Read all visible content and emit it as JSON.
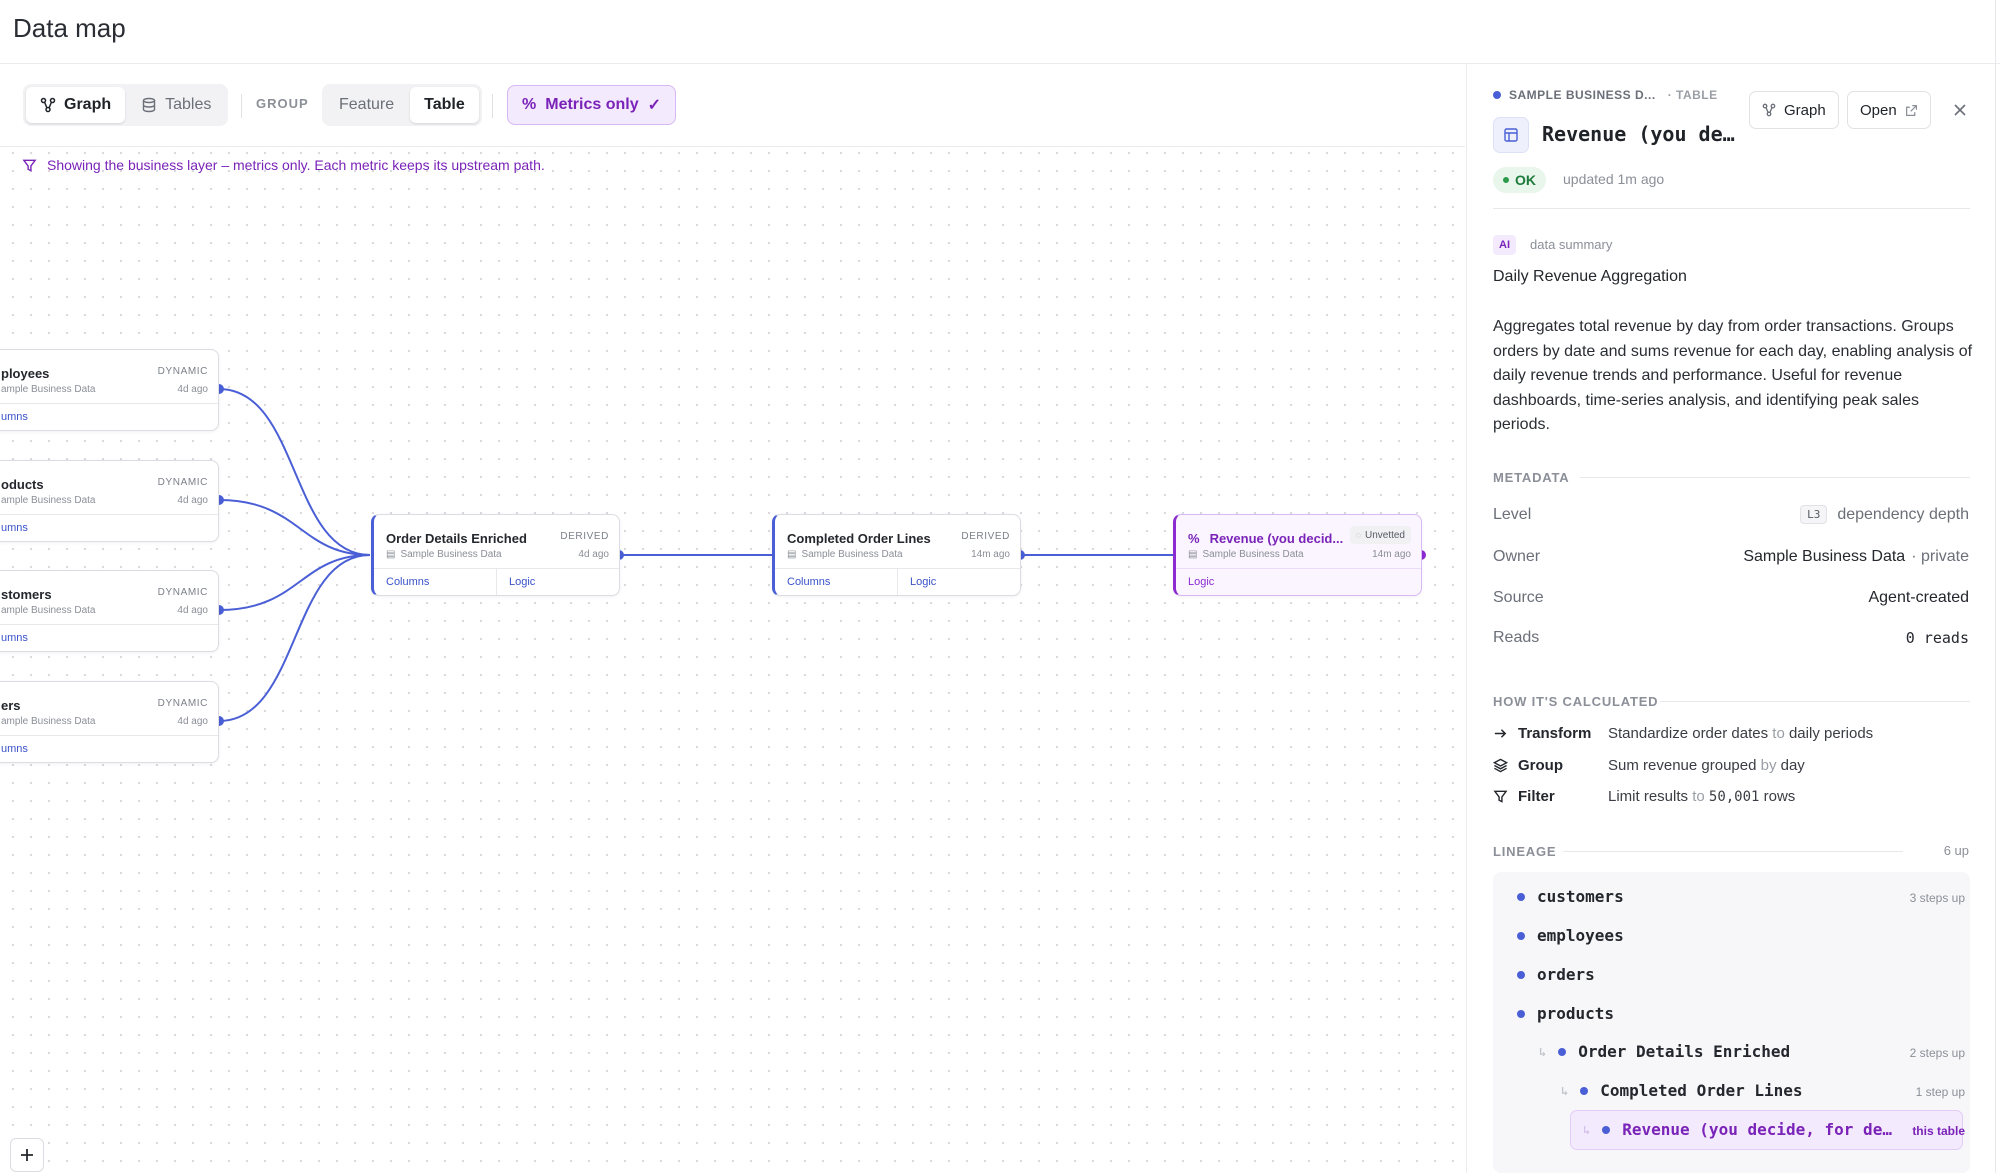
{
  "app": {
    "title": "Data map"
  },
  "toolbar": {
    "graph_label": "Graph",
    "tables_label": "Tables",
    "group_label": "GROUP",
    "feature_label": "Feature",
    "table_label": "Table",
    "metrics_label": "Metrics only"
  },
  "filter_note": "Showing the business layer – metrics only. Each metric keeps its upstream path.",
  "nodes": {
    "employees": {
      "name": "ployees",
      "tag": "DYNAMIC",
      "source": "ample Business Data",
      "age": "4d ago",
      "foot": "umns"
    },
    "products": {
      "name": "oducts",
      "tag": "DYNAMIC",
      "source": "ample Business Data",
      "age": "4d ago",
      "foot": "umns"
    },
    "customers": {
      "name": "stomers",
      "tag": "DYNAMIC",
      "source": "ample Business Data",
      "age": "4d ago",
      "foot": "umns"
    },
    "orders": {
      "name": "ers",
      "tag": "DYNAMIC",
      "source": "ample Business Data",
      "age": "4d ago",
      "foot": "umns"
    },
    "order_details": {
      "name": "Order Details Enriched",
      "tag": "DERIVED",
      "source": "Sample Business Data",
      "age": "4d ago",
      "columns": "Columns",
      "logic": "Logic"
    },
    "completed_lines": {
      "name": "Completed Order Lines",
      "tag": "DERIVED",
      "source": "Sample Business Data",
      "age": "14m ago",
      "columns": "Columns",
      "logic": "Logic"
    },
    "revenue": {
      "name": "Revenue (you decid...",
      "badge": "Unvetted",
      "source": "Sample Business Data",
      "age": "14m ago",
      "logic": "Logic"
    }
  },
  "panel": {
    "crumb_source": "SAMPLE BUSINESS D...",
    "crumb_type": "· TABLE",
    "graph_button": "Graph",
    "open_button": "Open",
    "title": "Revenue (you de…",
    "status": "OK",
    "updated": "updated 1m ago",
    "ai_badge": "AI",
    "ai_label": "data summary",
    "summary_title": "Daily Revenue Aggregation",
    "summary_body": "Aggregates total revenue by day from order transactions. Groups orders by date and sums revenue for each day, enabling analysis of daily revenue trends and performance. Useful for revenue dashboards, time-series analysis, and identifying peak sales periods.",
    "metadata_title": "METADATA",
    "meta": {
      "level_key": "Level",
      "level_badge": "L3",
      "level_value": "dependency depth",
      "owner_key": "Owner",
      "owner_value": "Sample Business Data",
      "owner_suffix": "· private",
      "source_key": "Source",
      "source_value": "Agent-created",
      "reads_key": "Reads",
      "reads_value": "0 reads"
    },
    "calc_title": "HOW IT'S CALCULATED",
    "calc": [
      {
        "label": "Transform",
        "a": "Standardize order dates",
        "mid": "to",
        "b": "daily periods"
      },
      {
        "label": "Group",
        "a": "Sum revenue grouped",
        "mid": "by",
        "b": "day"
      },
      {
        "label": "Filter",
        "a": "Limit results",
        "mid": "to",
        "b": "50,001",
        "c": "rows"
      }
    ],
    "lineage_title": "LINEAGE",
    "lineage_count": "6 up",
    "lineage": [
      {
        "name": "customers",
        "steps": "3 steps up"
      },
      {
        "name": "employees",
        "steps": ""
      },
      {
        "name": "orders",
        "steps": ""
      },
      {
        "name": "products",
        "steps": ""
      },
      {
        "name": "Order Details Enriched",
        "steps": "2 steps up"
      },
      {
        "name": "Completed Order Lines",
        "steps": "1 step up"
      },
      {
        "name": "Revenue (you decide, for de…",
        "steps": "this table"
      }
    ]
  }
}
